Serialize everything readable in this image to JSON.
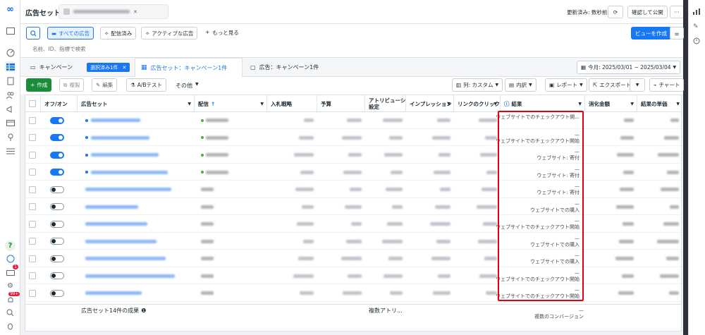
{
  "topbar": {
    "title": "広告セット",
    "tab_placeholder": "キャンペーン",
    "updated": "更新済み: 数秒前",
    "confirm_publish": "確認して公開",
    "more": "···"
  },
  "filters": {
    "all_ads": "すべての広告",
    "delivered": "配信済み",
    "active_ads": "アクティブな広告",
    "see_more": "もっと見る",
    "search_placeholder": "名前、ID、指標で検索",
    "create_view": "ビューを作成"
  },
  "tabs": {
    "campaign": "キャンペーン",
    "selected_badge": "選択済み1件",
    "adset": "広告セット：キャンペーン1件",
    "ad": "広告：キャンペーン1件",
    "date_range": "今月: 2025/03/01 ~ 2025/03/04"
  },
  "toolbar": {
    "create": "作成",
    "duplicate": "複製",
    "edit": "編集",
    "ab_test": "A/Bテスト",
    "other": "その他",
    "columns": "列: カスタム",
    "breakdown": "内訳",
    "report": "レポート",
    "export": "エクスポート",
    "chart": "チャート"
  },
  "table": {
    "headers": {
      "onoff": "オフ/オン",
      "adset": "広告セット",
      "delivery": "配信",
      "bid": "入札戦略",
      "budget": "予算",
      "attr1": "アトリビューション",
      "attr2": "設定",
      "impressions": "インプレッション",
      "clicks": "リンクのクリック",
      "results": "結果",
      "spend": "消化金額",
      "cpr": "結果の単価"
    },
    "rows": [
      {
        "on": true,
        "dash": "",
        "result": "ウェブサイトでのチェックアウト開..."
      },
      {
        "on": true,
        "dash": "—",
        "result": "ウェブサイトでのチェックアウト開始"
      },
      {
        "on": true,
        "dash": "—",
        "result": "ウェブサイト: 寄付"
      },
      {
        "on": true,
        "dash": "—",
        "result": "ウェブサイト: 寄付"
      },
      {
        "on": false,
        "dash": "—",
        "result": "ウェブサイト: 寄付"
      },
      {
        "on": false,
        "dash": "—",
        "result": "ウェブサイトでの購入"
      },
      {
        "on": false,
        "dash": "—",
        "result": "ウェブサイトでのチェックアウト開始"
      },
      {
        "on": false,
        "dash": "—",
        "result": "ウェブサイトでの購入"
      },
      {
        "on": false,
        "dash": "—",
        "result": "ウェブサイトでの購入"
      },
      {
        "on": false,
        "dash": "—",
        "result": "ウェブサイトでのチェックアウト開始"
      },
      {
        "on": false,
        "dash": "—",
        "result": "ウェブサイトでのチェックアウト開始"
      }
    ],
    "footer": {
      "summary": "広告セット14件の成果",
      "attr": "複数アトリ...",
      "results_dash": "—",
      "results_label": "複数のコンバージョン"
    }
  },
  "notifications": {
    "badge1": "1",
    "badge99": "99+"
  },
  "colors": {
    "accent": "#1877f2",
    "create_green": "#1a8c3a",
    "highlight": "#e3000f",
    "active_dot": "#42b72a"
  }
}
